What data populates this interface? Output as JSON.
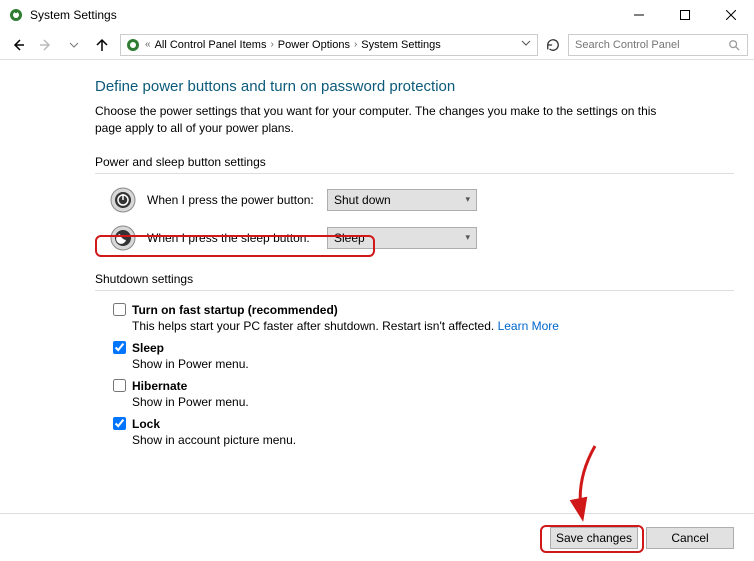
{
  "window": {
    "title": "System Settings"
  },
  "breadcrumb": {
    "items": [
      "All Control Panel Items",
      "Power Options",
      "System Settings"
    ]
  },
  "search": {
    "placeholder": "Search Control Panel"
  },
  "main": {
    "heading": "Define power buttons and turn on password protection",
    "intro": "Choose the power settings that you want for your computer. The changes you make to the settings on this page apply to all of your power plans.",
    "section1_label": "Power and sleep button settings",
    "power_button": {
      "label": "When I press the power button:",
      "value": "Shut down"
    },
    "sleep_button": {
      "label": "When I press the sleep button:",
      "value": "Sleep"
    },
    "section2_label": "Shutdown settings",
    "fast_startup": {
      "label": "Turn on fast startup (recommended)",
      "desc_prefix": "This helps start your PC faster after shutdown. Restart isn't affected. ",
      "learn_more": "Learn More",
      "checked": false
    },
    "sleep": {
      "label": "Sleep",
      "desc": "Show in Power menu.",
      "checked": true
    },
    "hibernate": {
      "label": "Hibernate",
      "desc": "Show in Power menu.",
      "checked": false
    },
    "lock": {
      "label": "Lock",
      "desc": "Show in account picture menu.",
      "checked": true
    }
  },
  "footer": {
    "save": "Save changes",
    "cancel": "Cancel"
  }
}
